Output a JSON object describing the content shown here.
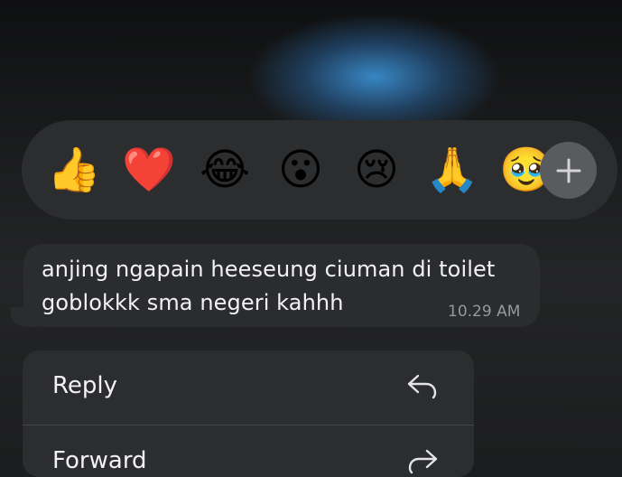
{
  "reactions": [
    {
      "emoji": "👍",
      "icon": "thumbs-up-icon"
    },
    {
      "emoji": "❤️",
      "icon": "heart-icon"
    },
    {
      "emoji": "😂",
      "icon": "tears-of-joy-icon"
    },
    {
      "emoji": "😮",
      "icon": "surprised-face-icon"
    },
    {
      "emoji": "😢",
      "icon": "crying-face-icon"
    },
    {
      "emoji": "🙏",
      "icon": "folded-hands-icon"
    },
    {
      "emoji": "🥹",
      "icon": "holding-back-tears-icon"
    }
  ],
  "add_reaction": {
    "icon": "plus-icon"
  },
  "message": {
    "line1": "anjing ngapain heeseung ciuman di toilet",
    "line2": "goblokkk sma negeri kahhh",
    "time": "10.29 AM"
  },
  "menu": {
    "items": [
      {
        "label": "Reply",
        "icon": "reply-arrow-icon"
      },
      {
        "label": "Forward",
        "icon": "forward-arrow-icon"
      }
    ]
  },
  "colors": {
    "background": "#1c1d1e",
    "panel": "#2c2d2e",
    "bubble": "#2b2c2e",
    "text": "#f2f2f4",
    "time": "#97989c",
    "blur_accent": "#3a8ccd"
  }
}
